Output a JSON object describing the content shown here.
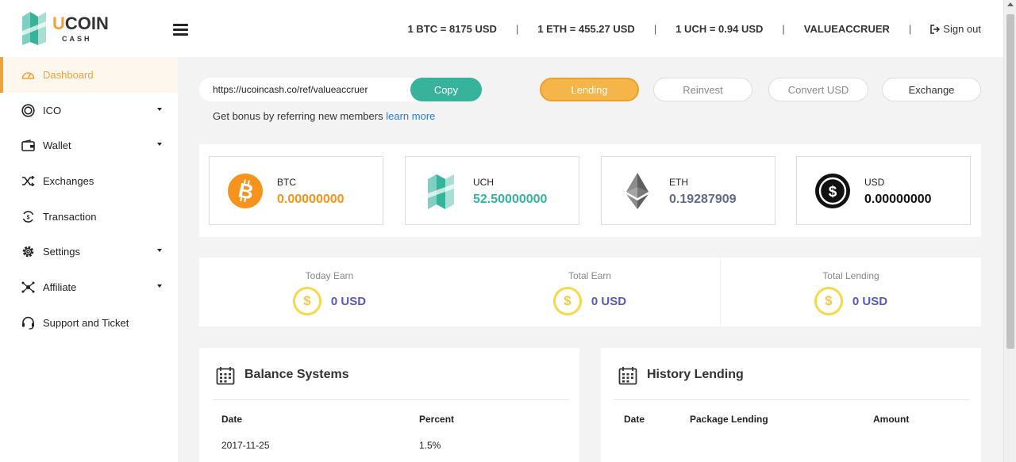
{
  "header": {
    "logo_text_1": "U",
    "logo_text_2": "COIN",
    "logo_sub": "CASH",
    "rates": [
      "1 BTC = 8175 USD",
      "1 ETH = 455.27 USD",
      "1 UCH = 0.94 USD"
    ],
    "username": "VALUEACCRUER",
    "sign_out": "Sign out"
  },
  "sidebar": {
    "items": [
      {
        "label": "Dashboard",
        "icon": "speedometer-icon",
        "active": true,
        "caret": false
      },
      {
        "label": "ICO",
        "icon": "coin-ring-icon",
        "active": false,
        "caret": true
      },
      {
        "label": "Wallet",
        "icon": "wallet-icon",
        "active": false,
        "caret": true
      },
      {
        "label": "Exchanges",
        "icon": "shuffle-icon",
        "active": false,
        "caret": false
      },
      {
        "label": "Transaction",
        "icon": "transaction-icon",
        "active": false,
        "caret": false
      },
      {
        "label": "Settings",
        "icon": "gear-icon",
        "active": false,
        "caret": true
      },
      {
        "label": "Affiliate",
        "icon": "network-icon",
        "active": false,
        "caret": true
      },
      {
        "label": "Support and Ticket",
        "icon": "headset-icon",
        "active": false,
        "caret": false
      }
    ]
  },
  "referral": {
    "url": "https://ucoincash.co/ref/valueaccruer",
    "copy_label": "Copy",
    "hint": "Get bonus by referring new members",
    "learn_more": "learn more"
  },
  "actions": {
    "lending": "Lending",
    "reinvest": "Reinvest",
    "convert_usd": "Convert USD",
    "exchange": "Exchange"
  },
  "balances": [
    {
      "name": "BTC",
      "value": "0.00000000",
      "color": "#f7931a"
    },
    {
      "name": "UCH",
      "value": "52.50000000",
      "color": "#36b39a"
    },
    {
      "name": "ETH",
      "value": "0.19287909",
      "color": "#62688f"
    },
    {
      "name": "USD",
      "value": "0.00000000",
      "color": "#111111"
    }
  ],
  "earnings": [
    {
      "title": "Today Earn",
      "value": "0 USD"
    },
    {
      "title": "Total Earn",
      "value": "0 USD"
    },
    {
      "title": "Total Lending",
      "value": "0 USD"
    }
  ],
  "balance_systems": {
    "title": "Balance Systems",
    "columns": [
      "Date",
      "Percent"
    ],
    "rows": [
      [
        "2017-11-25",
        "1.5%"
      ]
    ]
  },
  "history_lending": {
    "title": "History Lending",
    "columns": [
      "Date",
      "Package Lending",
      "Amount"
    ]
  },
  "colors": {
    "accent": "#f2a23a",
    "teal": "#36b39a",
    "value_blue": "#5858c4"
  }
}
